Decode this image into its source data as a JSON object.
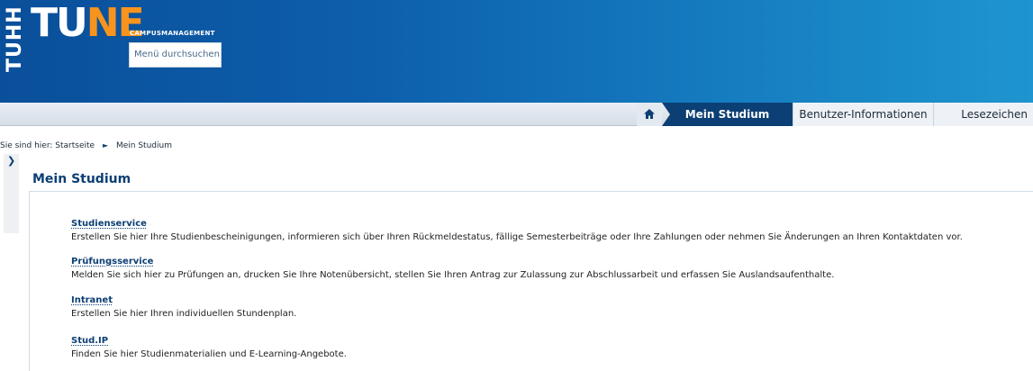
{
  "header": {
    "logo_vertical": "TUHH",
    "logo_tune_part1": "TU",
    "logo_tune_part2": "NE",
    "logo_subtitle": "CAMPUSMANAGEMENT",
    "search_placeholder": "Menü durchsuchen"
  },
  "nav": {
    "home_icon": "home-icon",
    "active_label": "Mein Studium",
    "items": [
      {
        "label": "Benutzer-Informationen"
      },
      {
        "label": "Lesezeichen"
      }
    ]
  },
  "breadcrumb": {
    "prefix": "Sie sind hier:",
    "home": "Startseite",
    "current": "Mein Studium"
  },
  "page": {
    "title": "Mein Studium"
  },
  "services": [
    {
      "title": "Studienservice",
      "description": "Erstellen Sie hier Ihre Studienbescheinigungen, informieren sich über Ihren Rückmeldestatus, fällige Semesterbeiträge oder Ihre Zahlungen oder nehmen Sie Änderungen an Ihren Kontaktdaten vor."
    },
    {
      "title": "Prüfungsservice",
      "description": "Melden Sie sich hier zu Prüfungen an, drucken Sie Ihre Notenübersicht, stellen Sie Ihren Antrag zur Zulassung zur Abschlussarbeit und erfassen Sie Auslandsaufenthalte."
    },
    {
      "title": "Intranet",
      "description": "Erstellen Sie hier Ihren individuellen Stundenplan."
    },
    {
      "title": "Stud.IP",
      "description": "Finden Sie hier Studienmaterialien und E-Learning-Angebote."
    }
  ],
  "colors": {
    "brand_blue": "#0c3f74",
    "accent_orange": "#f7941d"
  }
}
